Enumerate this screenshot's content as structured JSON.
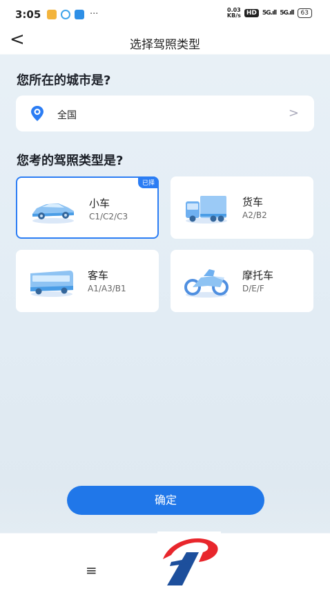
{
  "status_bar": {
    "time": "3:05",
    "dots": "···",
    "speed_top": "0.03",
    "speed_bottom": "KB/s",
    "hd": "HD",
    "sig1": "5G.ıll",
    "sig2": "5G.ıll",
    "battery": "63"
  },
  "nav": {
    "back": "<",
    "title": "选择驾照类型"
  },
  "city": {
    "heading": "您所在的城市是?",
    "value": "全国",
    "chevron": ">"
  },
  "license": {
    "heading": "您考的驾照类型是?",
    "selected_badge": "已择",
    "options": [
      {
        "name": "小车",
        "codes": "C1/C2/C3",
        "icon": "car-icon",
        "selected": true
      },
      {
        "name": "货车",
        "codes": "A2/B2",
        "icon": "truck-icon",
        "selected": false
      },
      {
        "name": "客车",
        "codes": "A1/A3/B1",
        "icon": "bus-icon",
        "selected": false
      },
      {
        "name": "摩托车",
        "codes": "D/E/F",
        "icon": "motorcycle-icon",
        "selected": false
      }
    ]
  },
  "confirm_label": "确定",
  "menu": "≡",
  "colors": {
    "accent": "#2b7df4",
    "button": "#2077e9",
    "logo_red": "#e8262c",
    "logo_blue": "#1d4f9c"
  }
}
